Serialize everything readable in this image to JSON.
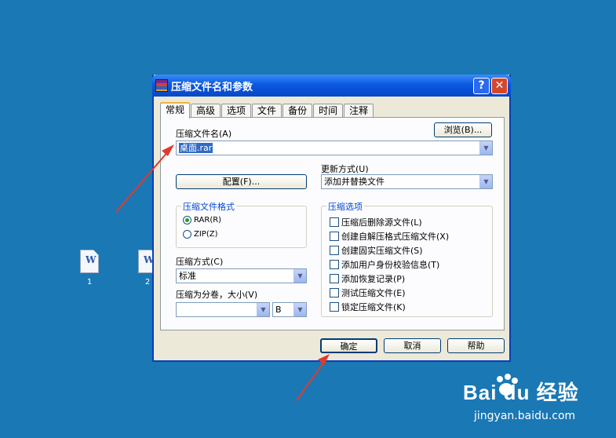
{
  "desktop": {
    "icons": [
      {
        "label": "1",
        "icon": "word-doc-icon"
      },
      {
        "label": "2",
        "icon": "word-doc-icon"
      }
    ]
  },
  "dialog": {
    "title": "压缩文件名和参数",
    "help_glyph": "?",
    "close_glyph": "✕",
    "tabs": [
      "常规",
      "高级",
      "选项",
      "文件",
      "备份",
      "时间",
      "注释"
    ],
    "active_tab": "常规",
    "archive_name_label": "压缩文件名(A)",
    "archive_name_value": "桌面.rar",
    "browse_button": "浏览(B)...",
    "config_button": "配置(F)...",
    "update_mode_label": "更新方式(U)",
    "update_mode_value": "添加并替换文件",
    "format_group": {
      "title": "压缩文件格式",
      "options": [
        {
          "label": "RAR(R)",
          "selected": true
        },
        {
          "label": "ZIP(Z)",
          "selected": false
        }
      ]
    },
    "compression_method_label": "压缩方式(C)",
    "compression_method_value": "标准",
    "split_label": "压缩为分卷，大小(V)",
    "split_value": "",
    "split_unit": "B",
    "options_group": {
      "title": "压缩选项",
      "items": [
        {
          "label": "压缩后删除源文件(L)",
          "checked": false
        },
        {
          "label": "创建自解压格式压缩文件(X)",
          "checked": false
        },
        {
          "label": "创建固实压缩文件(S)",
          "checked": false
        },
        {
          "label": "添加用户身份校验信息(T)",
          "checked": false
        },
        {
          "label": "添加恢复记录(P)",
          "checked": false
        },
        {
          "label": "测试压缩文件(E)",
          "checked": false
        },
        {
          "label": "锁定压缩文件(K)",
          "checked": false
        }
      ]
    },
    "ok_button": "确定",
    "cancel_button": "取消",
    "help_button": "帮助"
  },
  "watermark": {
    "logo_text": "Bai du 经验",
    "url": "jingyan.baidu.com"
  },
  "colors": {
    "desktop": "#1a78b4",
    "titlebar": "#0a58e0",
    "annotation_arrow": "#e03a30"
  }
}
